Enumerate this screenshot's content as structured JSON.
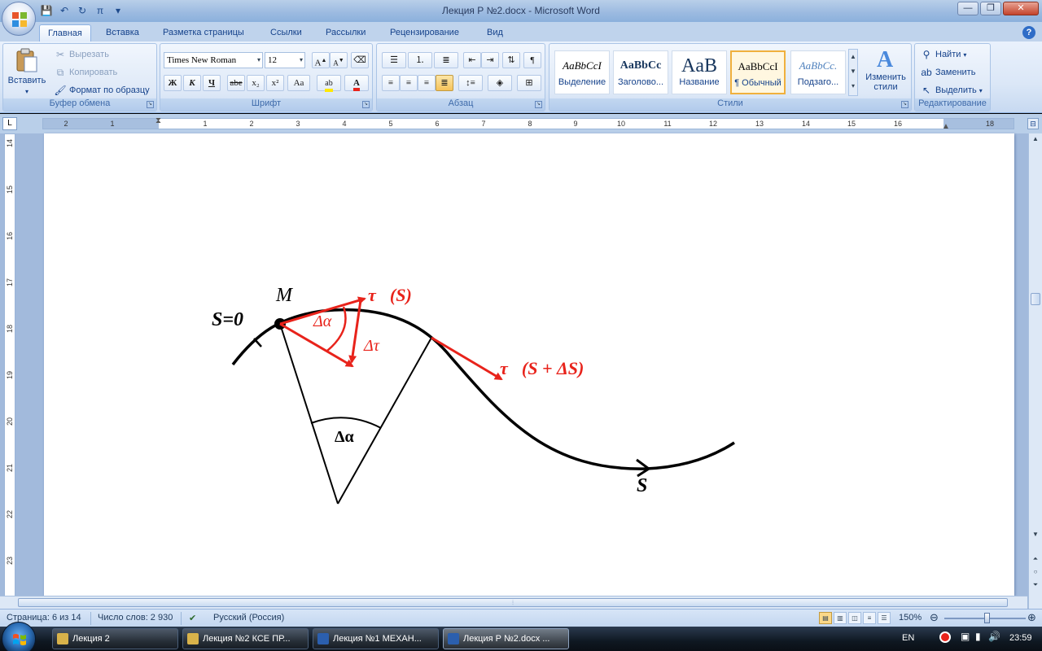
{
  "window": {
    "title": "Лекция Р №2.docx - Microsoft Word",
    "controls": {
      "minimize": "—",
      "maximize": "❐",
      "close": "✕"
    }
  },
  "quick_access": [
    {
      "icon": "save-icon",
      "glyph": "💾"
    },
    {
      "icon": "undo-icon",
      "glyph": "↶"
    },
    {
      "icon": "redo-icon",
      "glyph": "↻"
    },
    {
      "icon": "equation-icon",
      "glyph": "π"
    },
    {
      "icon": "customize-icon",
      "glyph": "▾"
    }
  ],
  "ribbon_tabs": [
    "Главная",
    "Вставка",
    "Разметка страницы",
    "Ссылки",
    "Рассылки",
    "Рецензирование",
    "Вид"
  ],
  "clipboard": {
    "paste": "Вставить",
    "cut": "Вырезать",
    "copy": "Копировать",
    "format_painter": "Формат по образцу",
    "label": "Буфер обмена"
  },
  "font": {
    "family": "Times New Roman",
    "size": "12",
    "grow": "A",
    "shrink": "A",
    "bold": "Ж",
    "italic": "К",
    "underline": "Ч",
    "strike": "abe",
    "subscript": "x₂",
    "superscript": "x²",
    "change_case": "Aa",
    "label": "Шрифт"
  },
  "paragraph": {
    "label": "Абзац"
  },
  "styles": {
    "items": [
      {
        "sample": "AaBbCcI",
        "name": "Выделение"
      },
      {
        "sample": "AaBbCc",
        "name": "Заголово..."
      },
      {
        "sample": "AaB",
        "name": "Название"
      },
      {
        "sample": "AaBbCcI",
        "name": "¶ Обычный"
      },
      {
        "sample": "AaBbCc.",
        "name": "Подзаго..."
      }
    ],
    "change": "Изменить стили",
    "label": "Стили"
  },
  "editing": {
    "find": "Найти",
    "replace": "Заменить",
    "select": "Выделить",
    "label": "Редактирование"
  },
  "ruler": {
    "tab_selector": "L",
    "h_numbers": [
      "2",
      "1",
      "1",
      "2",
      "3",
      "4",
      "5",
      "6",
      "7",
      "8",
      "9",
      "10",
      "11",
      "12",
      "13",
      "14",
      "15",
      "16",
      "18"
    ],
    "v_numbers": [
      "14",
      "15",
      "16",
      "17",
      "18",
      "19",
      "20",
      "21",
      "22",
      "23"
    ]
  },
  "diagram": {
    "point_label": "M",
    "origin_label": "S=0",
    "arc_label": "S",
    "delta_alpha_top": "Δα",
    "delta_tau": "Δτ",
    "tau_s": "τ⃗(S)",
    "tau_s_ds": "τ⃗(S + ΔS)",
    "delta_alpha_bottom": "Δα",
    "colors": {
      "vector": "#e8231b",
      "curve": "#000000"
    }
  },
  "status": {
    "page": "Страница: 6 из 14",
    "words": "Число слов: 2 930",
    "language": "Русский (Россия)",
    "zoom": "150%"
  },
  "taskbar": {
    "tasks": [
      "Лекция 2",
      "Лекция №2 КСЕ ПР...",
      "Лекция №1 МЕХАН...",
      "Лекция Р №2.docx ..."
    ],
    "lang": "EN",
    "time": "23:59"
  }
}
